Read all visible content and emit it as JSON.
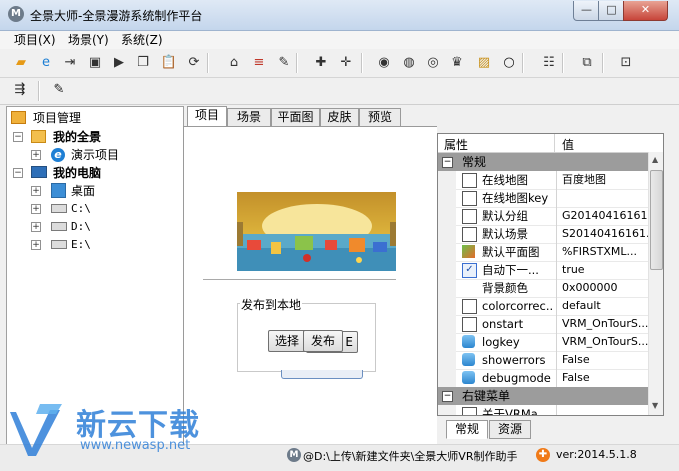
{
  "window": {
    "title": "全景大师-全景漫游系统制作平台",
    "app_icon_letter": "M",
    "min_label": "—",
    "max_label": "□",
    "close_label": "✕"
  },
  "menu": [
    {
      "label": "项目(X)"
    },
    {
      "label": "场景(Y)"
    },
    {
      "label": "系统(Z)"
    }
  ],
  "toolbar1": {
    "icons": [
      {
        "name": "open-folder-icon",
        "glyph": "▰",
        "color": "#e69a16"
      },
      {
        "name": "ie-icon",
        "glyph": "e",
        "color": "#1e7fd4"
      },
      {
        "name": "indent-icon",
        "glyph": "⇥",
        "color": "#333"
      },
      {
        "name": "floppy-icon",
        "glyph": "▣",
        "color": "#333"
      },
      {
        "name": "video-icon",
        "glyph": "▶",
        "color": "#333"
      },
      {
        "name": "copy-icon",
        "glyph": "❐",
        "color": "#333"
      },
      {
        "name": "paste-icon",
        "glyph": "📋",
        "color": "#333"
      },
      {
        "name": "refresh-icon",
        "glyph": "⟳",
        "color": "#333"
      },
      {
        "name": "home-icon",
        "glyph": "⌂",
        "color": "#333"
      },
      {
        "name": "list-icon",
        "glyph": "≡",
        "color": "#c0392b"
      },
      {
        "name": "document-edit-icon",
        "glyph": "✎",
        "color": "#333"
      },
      {
        "name": "hotspot-add-icon",
        "glyph": "✚",
        "color": "#333"
      },
      {
        "name": "hotspot-remove-icon",
        "glyph": "✛",
        "color": "#333"
      },
      {
        "name": "camera-icon",
        "glyph": "◉",
        "color": "#333"
      },
      {
        "name": "camera-lock-icon",
        "glyph": "◍",
        "color": "#333"
      },
      {
        "name": "camera-settings-icon",
        "glyph": "◎",
        "color": "#333"
      },
      {
        "name": "hat-icon",
        "glyph": "♛",
        "color": "#333"
      },
      {
        "name": "picture-icon",
        "glyph": "▨",
        "color": "#c89018"
      },
      {
        "name": "ring-icon",
        "glyph": "○",
        "color": "#111"
      },
      {
        "name": "grid-icon",
        "glyph": "☷",
        "color": "#333"
      },
      {
        "name": "layers-icon",
        "glyph": "⧉",
        "color": "#333"
      },
      {
        "name": "panel-icon",
        "glyph": "⊡",
        "color": "#333"
      }
    ]
  },
  "toolbar2": {
    "icons": [
      {
        "name": "publish-exe-icon",
        "glyph": "⇶",
        "color": "#222"
      },
      {
        "name": "edit-note-icon",
        "glyph": "✎",
        "color": "#222"
      }
    ]
  },
  "tree": {
    "root": "项目管理",
    "my_panorama": "我的全景",
    "demo_project": "演示项目",
    "my_computer": "我的电脑",
    "desktop": "桌面",
    "drive_c": "C:\\",
    "drive_d": "D:\\",
    "drive_e": "E:\\"
  },
  "tabs": [
    {
      "label": "项目",
      "active": true
    },
    {
      "label": "场景",
      "active": false
    },
    {
      "label": "平面图",
      "active": false
    },
    {
      "label": "皮肤",
      "active": false
    },
    {
      "label": "预览",
      "active": false
    }
  ],
  "publish": {
    "group_label": "发布到本地",
    "select_button": "选择",
    "publish_button": "发布"
  },
  "property_grid": {
    "header_name": "属性",
    "header_value": "值",
    "categories": [
      {
        "label": "常规",
        "rows": [
          {
            "name": "在线地图",
            "value": "百度地图",
            "icon": "edit-doc-icon"
          },
          {
            "name": "在线地图key",
            "value": "",
            "icon": "edit-doc-icon"
          },
          {
            "name": "默认分组",
            "value": "G20140416161...",
            "icon": "page-icon"
          },
          {
            "name": "默认场景",
            "value": "S20140416161...",
            "icon": "page-icon"
          },
          {
            "name": "默认平面图",
            "value": "%FIRSTXML...",
            "icon": "map-image-icon"
          },
          {
            "name": "自动下一...",
            "value": "true",
            "icon": "checkbox-icon"
          },
          {
            "name": "背景颜色",
            "value": "0x000000",
            "icon": ""
          },
          {
            "name": "colorcorrec...",
            "value": "default",
            "icon": "edit-doc-icon"
          },
          {
            "name": "onstart",
            "value": "VRM_OnTourS...",
            "icon": "edit-doc-icon"
          },
          {
            "name": "logkey",
            "value": "VRM_OnTourS...",
            "icon": "database-icon"
          },
          {
            "name": "showerrors",
            "value": "False",
            "icon": "database-icon"
          },
          {
            "name": "debugmode",
            "value": "False",
            "icon": "database-icon"
          }
        ]
      },
      {
        "label": "右键菜单",
        "rows": [
          {
            "name": "关于VRMa...",
            "value": "",
            "icon": "edit-doc-icon"
          }
        ]
      }
    ],
    "bottom_tabs": [
      "常规",
      "资源"
    ]
  },
  "statusbar": {
    "path": "@D:\\上传\\新建文件夹\\全景大师VR制作助手",
    "version": "ver:2014.5.1.8"
  },
  "watermark": {
    "brand": "新云下载",
    "url": "www.newasp.net"
  }
}
